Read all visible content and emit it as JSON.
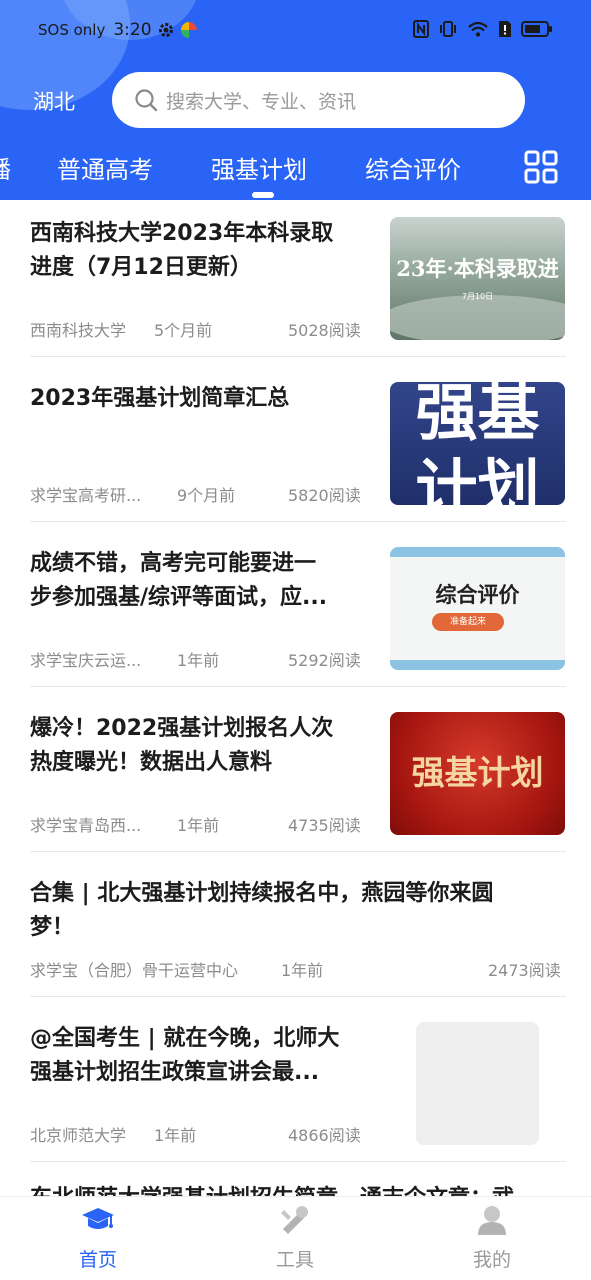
{
  "status_bar": {
    "sos_text": "SOS only",
    "time": "3:20"
  },
  "header": {
    "region": "湖北",
    "search_placeholder": "搜索大学、专业、资讯",
    "partial_tab": "播",
    "tabs": [
      "普通高考",
      "强基计划",
      "综合评价"
    ],
    "active_tab": "强基计划"
  },
  "feed": [
    {
      "title_line1": "西南科技大学2023年本科录取",
      "title_line2": "进度（7月12日更新）",
      "source": "西南科技大学",
      "time": "5个月前",
      "reads": "5028阅读",
      "thumb_text": "23年·本科录取进",
      "thumb_sub": "7月10日"
    },
    {
      "title_line1": "2023年强基计划简章汇总",
      "title_line2": "",
      "source": "求学宝高考研...",
      "time": "9个月前",
      "reads": "5820阅读",
      "thumb_text": "强基",
      "thumb_sub": "计划"
    },
    {
      "title_line1": "成绩不错，高考完可能要进一",
      "title_line2": "步参加强基/综评等面试，应...",
      "source": "求学宝庆云运...",
      "time": "1年前",
      "reads": "5292阅读",
      "thumb_text": "综合评价",
      "thumb_sub": "准备起来"
    },
    {
      "title_line1": "爆冷！2022强基计划报名人次",
      "title_line2": "热度曝光！数据出人意料",
      "source": "求学宝青岛西...",
      "time": "1年前",
      "reads": "4735阅读",
      "thumb_text": "强基计划",
      "thumb_sub": ""
    },
    {
      "title_line1": "合集 | 北大强基计划持续报名中，燕园等你来圆",
      "title_line2": "梦！",
      "source": "求学宝（合肥）骨干运营中心",
      "time": "1年前",
      "reads": "2473阅读"
    },
    {
      "title_line1": "@全国考生 | 就在今晚，北师大",
      "title_line2": "强基计划招生政策宣讲会最...",
      "source": "北京师范大学",
      "time": "1年前",
      "reads": "4866阅读"
    },
    {
      "title_line1": "东北师范大学强基计划招生简章，通志企文章：武"
    }
  ],
  "bottom_nav": [
    {
      "label": "首页",
      "icon": "graduation-cap-icon",
      "active": true
    },
    {
      "label": "工具",
      "icon": "tools-icon",
      "active": false
    },
    {
      "label": "我的",
      "icon": "user-icon",
      "active": false
    }
  ],
  "colors": {
    "primary": "#2a64f6",
    "nav_active": "#2a64f6",
    "nav_inactive": "#9a9a9a"
  }
}
